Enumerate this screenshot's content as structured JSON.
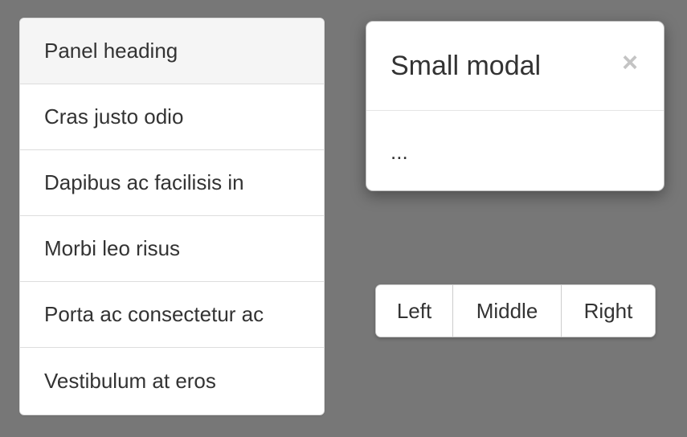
{
  "panel": {
    "heading": "Panel heading",
    "items": [
      {
        "label": "Cras justo odio"
      },
      {
        "label": "Dapibus ac facilisis in"
      },
      {
        "label": "Morbi leo risus"
      },
      {
        "label": "Porta ac consectetur ac"
      },
      {
        "label": "Vestibulum at eros"
      }
    ]
  },
  "modal": {
    "title": "Small modal",
    "close_symbol": "×",
    "body": "..."
  },
  "button_group": {
    "left_label": "Left",
    "middle_label": "Middle",
    "right_label": "Right"
  },
  "colors": {
    "background": "#777777",
    "panel_heading_bg": "#f5f5f5",
    "border": "#dddddd",
    "text": "#333333",
    "close_icon": "#c4c4c4"
  }
}
